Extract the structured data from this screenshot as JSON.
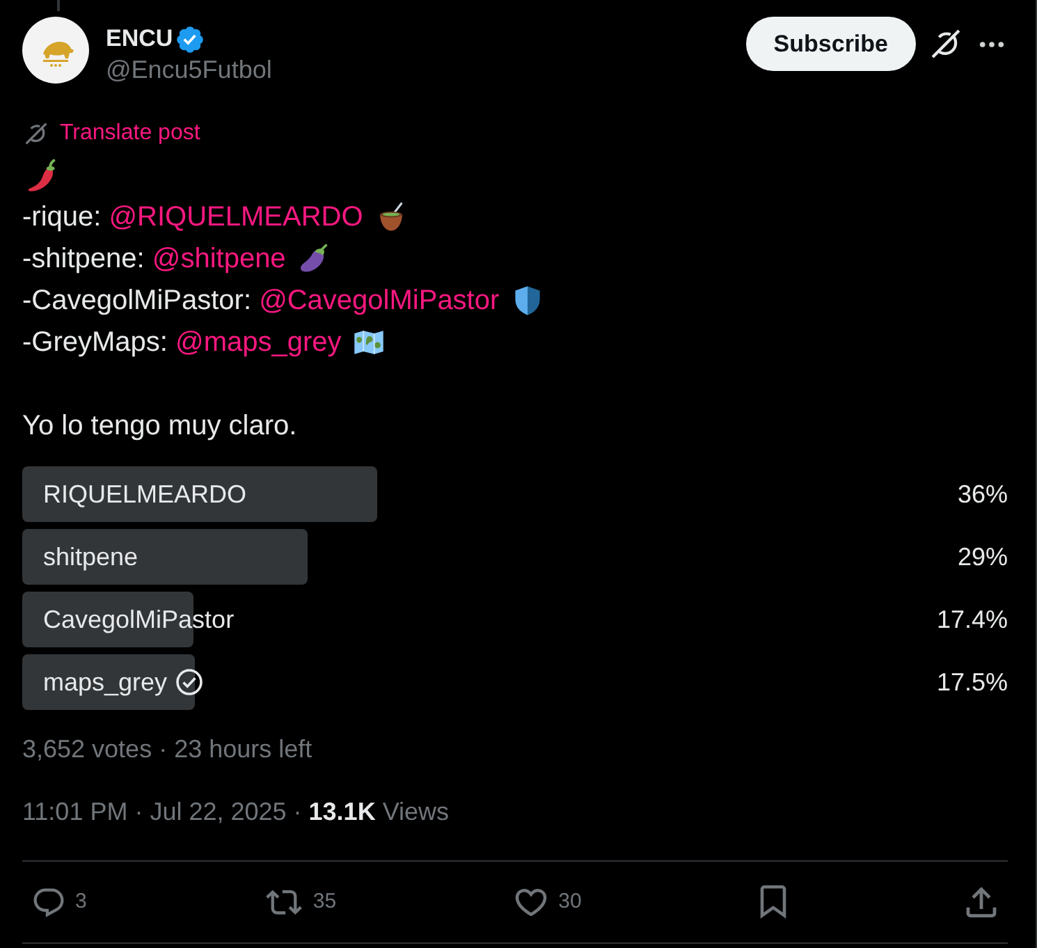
{
  "author": {
    "name": "ENCU",
    "verified": true,
    "handle": "@Encu5Futbol"
  },
  "subscribe": "Subscribe",
  "translate": "Translate post",
  "post": {
    "lines": [
      {
        "label": "-rique:",
        "mention": "@RIQUELMEARDO"
      },
      {
        "label": "-shitpene:",
        "mention": "@shitpene"
      },
      {
        "label": "-CavegolMiPastor:",
        "mention": "@CavegolMiPastor"
      },
      {
        "label": "-GreyMaps:",
        "mention": "@maps_grey"
      }
    ],
    "closing": "Yo lo tengo muy claro."
  },
  "poll": {
    "options": [
      {
        "label": "RIQUELMEARDO",
        "percent": "36%",
        "level": 0.36,
        "selected": false
      },
      {
        "label": "shitpene",
        "percent": "29%",
        "level": 0.29,
        "selected": false
      },
      {
        "label": "CavegolMiPastor",
        "percent": "17.4%",
        "level": 0.174,
        "selected": false
      },
      {
        "label": "maps_grey",
        "percent": "17.5%",
        "level": 0.175,
        "selected": true
      }
    ],
    "summary": "3,652 votes · 23 hours left"
  },
  "meta": "11:01 PM · Jul 22, 2025 · **13.1K** Views",
  "actions": [
    {
      "kind": "reply",
      "count": "3"
    },
    {
      "kind": "repost",
      "count": "35"
    },
    {
      "kind": "like",
      "count": "30"
    },
    {
      "kind": "bookmark"
    },
    {
      "kind": "share"
    }
  ]
}
